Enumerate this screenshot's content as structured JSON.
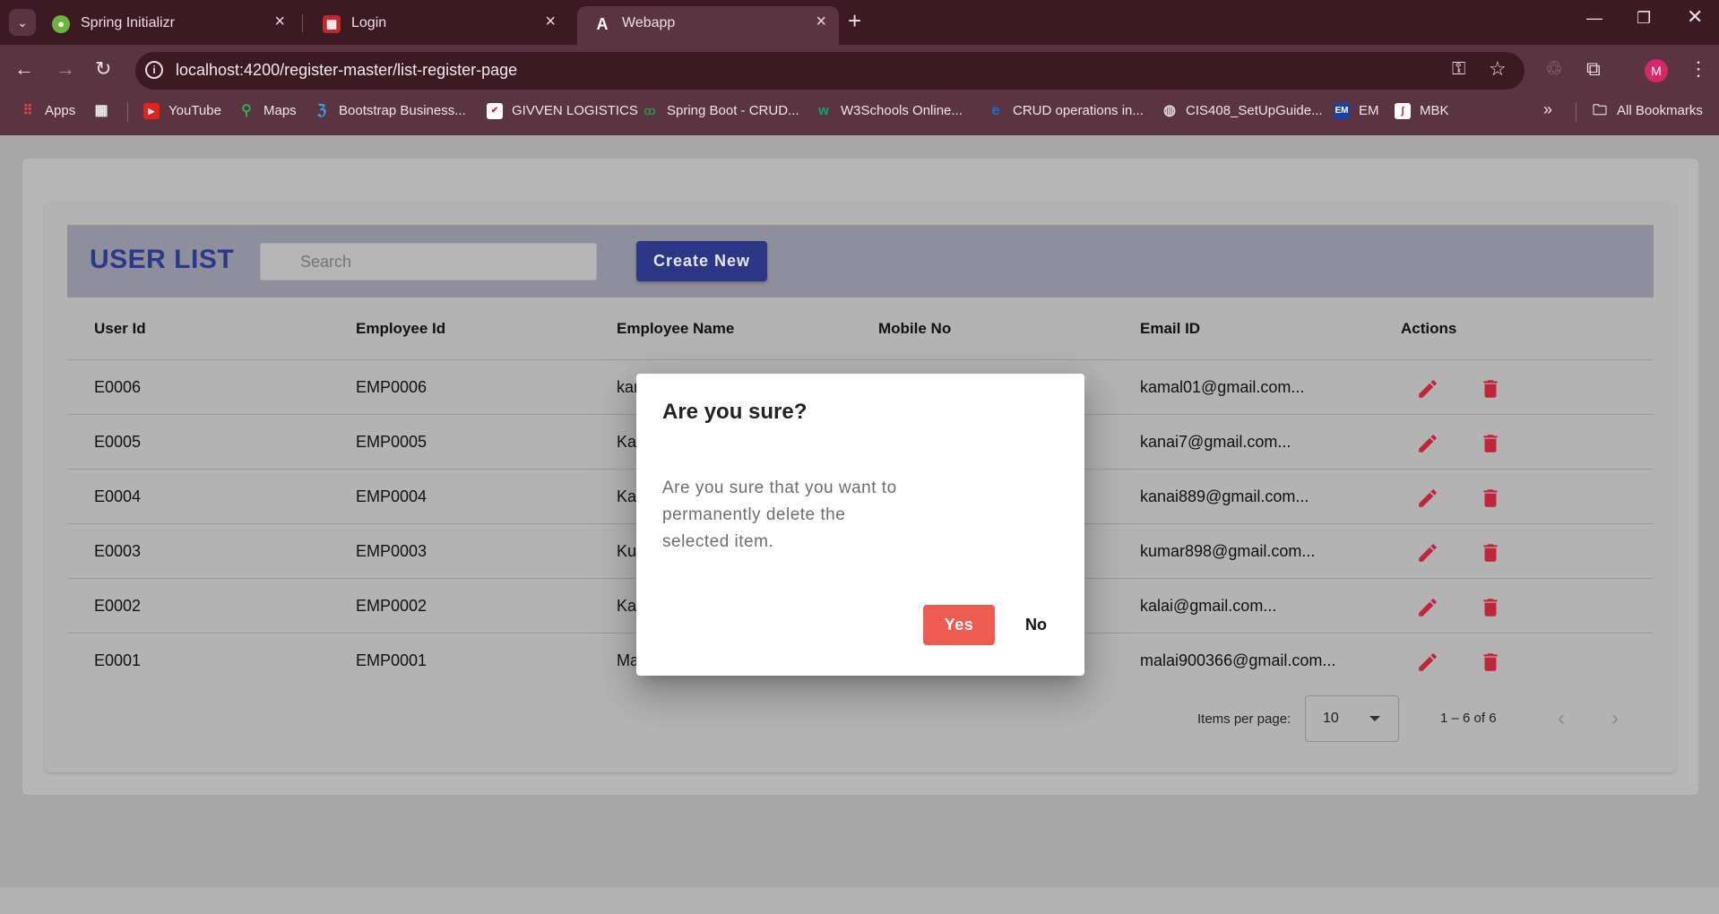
{
  "browser": {
    "tabs": [
      {
        "title": "Spring Initializr",
        "icon": "spring-icon",
        "active": false
      },
      {
        "title": "Login",
        "icon": "app-icon",
        "active": false
      },
      {
        "title": "Webapp",
        "icon": "angular-icon",
        "active": true
      }
    ],
    "url": "localhost:4200/register-master/list-register-page",
    "avatar_letter": "M",
    "bookmarks": [
      {
        "label": "Apps"
      },
      {
        "label": "YouTube"
      },
      {
        "label": "Maps"
      },
      {
        "label": "Bootstrap Business..."
      },
      {
        "label": "GIVVEN LOGISTICS"
      },
      {
        "label": "Spring Boot - CRUD..."
      },
      {
        "label": "W3Schools Online..."
      },
      {
        "label": "CRUD operations in..."
      },
      {
        "label": "CIS408_SetUpGuide..."
      },
      {
        "label": "EM"
      },
      {
        "label": "MBK"
      }
    ],
    "all_bookmarks": "All Bookmarks"
  },
  "page": {
    "title": "USER LIST",
    "search_placeholder": "Search",
    "create_button": "Create New",
    "columns": [
      "User Id",
      "Employee Id",
      "Employee Name",
      "Mobile No",
      "Email ID",
      "Actions"
    ],
    "rows": [
      {
        "user_id": "E0006",
        "employee_id": "EMP0006",
        "name_partial": "kar",
        "email": "kamal01@gmail.com..."
      },
      {
        "user_id": "E0005",
        "employee_id": "EMP0005",
        "name_partial": "Ka",
        "email": "kanai7@gmail.com..."
      },
      {
        "user_id": "E0004",
        "employee_id": "EMP0004",
        "name_partial": "Ka",
        "email": "kanai889@gmail.com..."
      },
      {
        "user_id": "E0003",
        "employee_id": "EMP0003",
        "name_partial": "Ku",
        "email": "kumar898@gmail.com..."
      },
      {
        "user_id": "E0002",
        "employee_id": "EMP0002",
        "name_partial": "Ka",
        "email": "kalai@gmail.com..."
      },
      {
        "user_id": "E0001",
        "employee_id": "EMP0001",
        "name_partial": "Ma",
        "email": "malai900366@gmail.com..."
      }
    ],
    "paginator": {
      "items_per_page_label": "Items per page:",
      "page_size": "10",
      "range": "1 – 6 of 6"
    }
  },
  "dialog": {
    "title": "Are you sure?",
    "message": "Are you sure that you want to permanently delete the selected item.",
    "yes": "Yes",
    "no": "No"
  },
  "colors": {
    "accent": "#2b3784",
    "danger": "#ee5b50",
    "icon_red": "#c0253c",
    "chrome": "#3b1a24"
  }
}
